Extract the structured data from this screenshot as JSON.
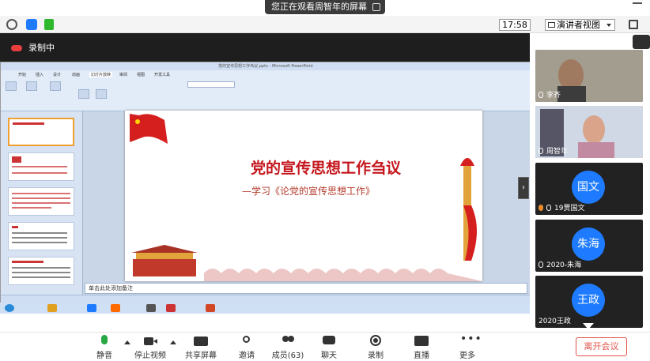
{
  "banner": {
    "sharing_text": "您正在观看周智年的屏幕"
  },
  "toolbar_top": {
    "time": "17:58",
    "view_label": "演讲者视图"
  },
  "recording": {
    "label": "录制中"
  },
  "ppt": {
    "window_title": "党的宣传思想工作刍议.pptx - Microsoft PowerPoint",
    "tabs": [
      "开始",
      "插入",
      "设计",
      "动画",
      "幻灯片放映",
      "审阅",
      "视图",
      "开发工具"
    ],
    "slide_title": "党的宣传思想工作刍议",
    "slide_subtitle": "—学习《论党的宣传思想工作》",
    "notes_placeholder": "单击此处添加备注"
  },
  "participants": [
    {
      "name": "李齐",
      "type": "video"
    },
    {
      "name": "周智年",
      "type": "video"
    },
    {
      "name": "19贾国文",
      "avatar_text": "国文",
      "type": "avatar"
    },
    {
      "name": "2020-朱海",
      "avatar_text": "朱海",
      "type": "avatar"
    },
    {
      "name": "2020王政",
      "avatar_text": "王政",
      "type": "avatar"
    }
  ],
  "bottom_bar": {
    "mute": "静音",
    "stop_video": "停止视频",
    "share_screen": "共享屏幕",
    "invite": "邀请",
    "members": "成员(63)",
    "chat": "聊天",
    "record": "录制",
    "live": "直播",
    "more": "更多",
    "leave": "离开会议"
  },
  "colors": {
    "accent": "#1e7bff",
    "leave": "#e0544a",
    "slide_red": "#c4161c"
  }
}
